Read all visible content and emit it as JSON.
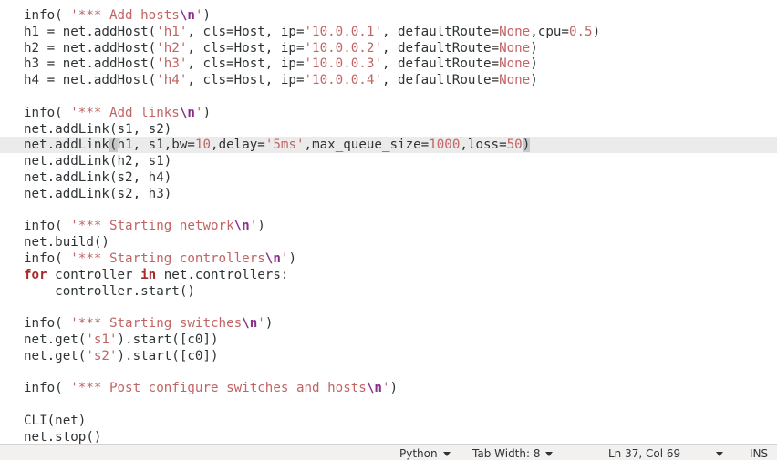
{
  "editor": {
    "current_line_index": 8,
    "lines": [
      [
        {
          "t": "info( ",
          "c": "default"
        },
        {
          "t": "'*** Add hosts",
          "c": "str"
        },
        {
          "t": "\\n",
          "c": "esc"
        },
        {
          "t": "'",
          "c": "str"
        },
        {
          "t": ")",
          "c": "default"
        }
      ],
      [
        {
          "t": "h1 = net.addHost(",
          "c": "default"
        },
        {
          "t": "'h1'",
          "c": "str"
        },
        {
          "t": ", cls=Host, ip=",
          "c": "default"
        },
        {
          "t": "'10.0.0.1'",
          "c": "str"
        },
        {
          "t": ", defaultRoute=",
          "c": "default"
        },
        {
          "t": "None",
          "c": "const"
        },
        {
          "t": ",cpu=",
          "c": "default"
        },
        {
          "t": "0.5",
          "c": "num"
        },
        {
          "t": ")",
          "c": "default"
        }
      ],
      [
        {
          "t": "h2 = net.addHost(",
          "c": "default"
        },
        {
          "t": "'h2'",
          "c": "str"
        },
        {
          "t": ", cls=Host, ip=",
          "c": "default"
        },
        {
          "t": "'10.0.0.2'",
          "c": "str"
        },
        {
          "t": ", defaultRoute=",
          "c": "default"
        },
        {
          "t": "None",
          "c": "const"
        },
        {
          "t": ")",
          "c": "default"
        }
      ],
      [
        {
          "t": "h3 = net.addHost(",
          "c": "default"
        },
        {
          "t": "'h3'",
          "c": "str"
        },
        {
          "t": ", cls=Host, ip=",
          "c": "default"
        },
        {
          "t": "'10.0.0.3'",
          "c": "str"
        },
        {
          "t": ", defaultRoute=",
          "c": "default"
        },
        {
          "t": "None",
          "c": "const"
        },
        {
          "t": ")",
          "c": "default"
        }
      ],
      [
        {
          "t": "h4 = net.addHost(",
          "c": "default"
        },
        {
          "t": "'h4'",
          "c": "str"
        },
        {
          "t": ", cls=Host, ip=",
          "c": "default"
        },
        {
          "t": "'10.0.0.4'",
          "c": "str"
        },
        {
          "t": ", defaultRoute=",
          "c": "default"
        },
        {
          "t": "None",
          "c": "const"
        },
        {
          "t": ")",
          "c": "default"
        }
      ],
      [],
      [
        {
          "t": "info( ",
          "c": "default"
        },
        {
          "t": "'*** Add links",
          "c": "str"
        },
        {
          "t": "\\n",
          "c": "esc"
        },
        {
          "t": "'",
          "c": "str"
        },
        {
          "t": ")",
          "c": "default"
        }
      ],
      [
        {
          "t": "net.addLink(s1, s2)",
          "c": "default"
        }
      ],
      [
        {
          "t": "net.addLink",
          "c": "default"
        },
        {
          "t": "(",
          "c": "bracket"
        },
        {
          "t": "h1, s1,bw=",
          "c": "default"
        },
        {
          "t": "10",
          "c": "num"
        },
        {
          "t": ",delay=",
          "c": "default"
        },
        {
          "t": "'5ms'",
          "c": "str"
        },
        {
          "t": ",max_queue_size=",
          "c": "default"
        },
        {
          "t": "1000",
          "c": "num"
        },
        {
          "t": ",loss=",
          "c": "default"
        },
        {
          "t": "50",
          "c": "num"
        },
        {
          "t": ")",
          "c": "bracket"
        }
      ],
      [
        {
          "t": "net.addLink(h2, s1)",
          "c": "default"
        }
      ],
      [
        {
          "t": "net.addLink(s2, h4)",
          "c": "default"
        }
      ],
      [
        {
          "t": "net.addLink(s2, h3)",
          "c": "default"
        }
      ],
      [],
      [
        {
          "t": "info( ",
          "c": "default"
        },
        {
          "t": "'*** Starting network",
          "c": "str"
        },
        {
          "t": "\\n",
          "c": "esc"
        },
        {
          "t": "'",
          "c": "str"
        },
        {
          "t": ")",
          "c": "default"
        }
      ],
      [
        {
          "t": "net.build()",
          "c": "default"
        }
      ],
      [
        {
          "t": "info( ",
          "c": "default"
        },
        {
          "t": "'*** Starting controllers",
          "c": "str"
        },
        {
          "t": "\\n",
          "c": "esc"
        },
        {
          "t": "'",
          "c": "str"
        },
        {
          "t": ")",
          "c": "default"
        }
      ],
      [
        {
          "t": "for",
          "c": "kw"
        },
        {
          "t": " controller ",
          "c": "default"
        },
        {
          "t": "in",
          "c": "kw"
        },
        {
          "t": " net.controllers:",
          "c": "default"
        }
      ],
      [
        {
          "t": "    controller.start()",
          "c": "default"
        }
      ],
      [],
      [
        {
          "t": "info( ",
          "c": "default"
        },
        {
          "t": "'*** Starting switches",
          "c": "str"
        },
        {
          "t": "\\n",
          "c": "esc"
        },
        {
          "t": "'",
          "c": "str"
        },
        {
          "t": ")",
          "c": "default"
        }
      ],
      [
        {
          "t": "net.get(",
          "c": "default"
        },
        {
          "t": "'s1'",
          "c": "str"
        },
        {
          "t": ").start([c0])",
          "c": "default"
        }
      ],
      [
        {
          "t": "net.get(",
          "c": "default"
        },
        {
          "t": "'s2'",
          "c": "str"
        },
        {
          "t": ").start([c0])",
          "c": "default"
        }
      ],
      [],
      [
        {
          "t": "info( ",
          "c": "default"
        },
        {
          "t": "'*** Post configure switches and hosts",
          "c": "str"
        },
        {
          "t": "\\n",
          "c": "esc"
        },
        {
          "t": "'",
          "c": "str"
        },
        {
          "t": ")",
          "c": "default"
        }
      ],
      [],
      [
        {
          "t": "CLI(net)",
          "c": "default"
        }
      ],
      [
        {
          "t": "net.stop()",
          "c": "default"
        }
      ]
    ]
  },
  "statusbar": {
    "language": "Python",
    "tab_width": "Tab Width: 8",
    "cursor_position": "Ln 37, Col 69",
    "insert_mode": "INS"
  }
}
